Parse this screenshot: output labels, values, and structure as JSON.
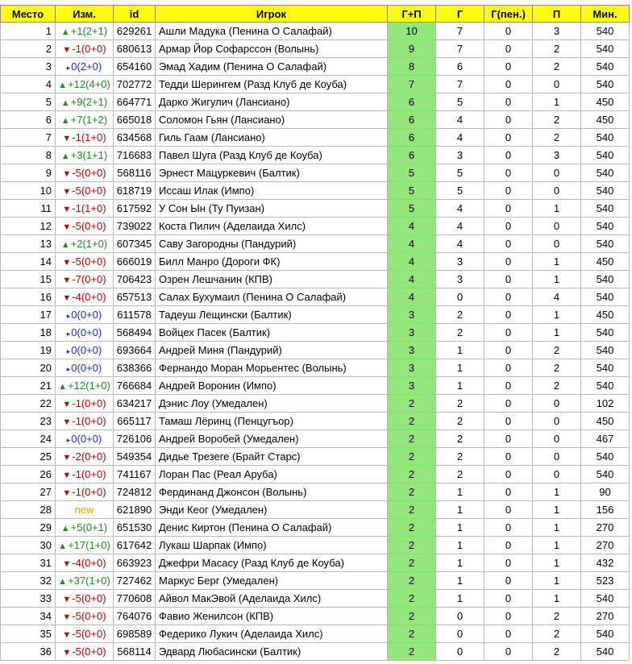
{
  "headers": [
    "Место",
    "Изм.",
    "id",
    "Игрок",
    "Г+П",
    "Г",
    "Г(пен.)",
    "П",
    "Мин."
  ],
  "colors": {
    "header_bg": "#ffff00",
    "gp_bg": "#92e67a",
    "up": "#1f8a1f",
    "down": "#c00000",
    "same": "#1530d0",
    "new": "#f0a000"
  },
  "rows": [
    {
      "place": "1",
      "dir": "up",
      "chg": "+1(2+1)",
      "id": "629261",
      "player": "Ашли Мадука (Пенина О Салафай)",
      "gp": "10",
      "g": "7",
      "gpen": "0",
      "p": "3",
      "min": "540"
    },
    {
      "place": "2",
      "dir": "down",
      "chg": "-1(0+0)",
      "id": "680613",
      "player": "Армар Йор Софарссон (Волынь)",
      "gp": "9",
      "g": "7",
      "gpen": "0",
      "p": "2",
      "min": "540"
    },
    {
      "place": "3",
      "dir": "same",
      "chg": "0(2+0)",
      "id": "654160",
      "player": "Эмад Хадим (Пенина О Салафай)",
      "gp": "8",
      "g": "6",
      "gpen": "0",
      "p": "2",
      "min": "540"
    },
    {
      "place": "4",
      "dir": "up",
      "chg": "+12(4+0)",
      "id": "702772",
      "player": "Тедди Шерингем (Разд Клуб де Коуба)",
      "gp": "7",
      "g": "7",
      "gpen": "0",
      "p": "0",
      "min": "540"
    },
    {
      "place": "5",
      "dir": "up",
      "chg": "+9(2+1)",
      "id": "664771",
      "player": "Дарко Жигулич (Лансиано)",
      "gp": "6",
      "g": "5",
      "gpen": "0",
      "p": "1",
      "min": "450"
    },
    {
      "place": "6",
      "dir": "up",
      "chg": "+7(1+2)",
      "id": "665018",
      "player": "Соломон Гьян (Лансиано)",
      "gp": "6",
      "g": "4",
      "gpen": "0",
      "p": "2",
      "min": "450"
    },
    {
      "place": "7",
      "dir": "down",
      "chg": "-1(1+0)",
      "id": "634568",
      "player": "Гиль Гаам (Лансиано)",
      "gp": "6",
      "g": "4",
      "gpen": "0",
      "p": "2",
      "min": "540"
    },
    {
      "place": "8",
      "dir": "up",
      "chg": "+3(1+1)",
      "id": "716683",
      "player": "Павел Шуга (Разд Клуб де Коуба)",
      "gp": "6",
      "g": "3",
      "gpen": "0",
      "p": "3",
      "min": "540"
    },
    {
      "place": "9",
      "dir": "down",
      "chg": "-5(0+0)",
      "id": "568116",
      "player": "Эрнест Мацуркевич (Балтик)",
      "gp": "5",
      "g": "5",
      "gpen": "0",
      "p": "0",
      "min": "540"
    },
    {
      "place": "10",
      "dir": "down",
      "chg": "-5(0+0)",
      "id": "618719",
      "player": "Иссаш Илак (Импо)",
      "gp": "5",
      "g": "5",
      "gpen": "0",
      "p": "0",
      "min": "540"
    },
    {
      "place": "11",
      "dir": "down",
      "chg": "-1(1+0)",
      "id": "617592",
      "player": "У Сон Ын (Ту Пуизан)",
      "gp": "5",
      "g": "4",
      "gpen": "0",
      "p": "1",
      "min": "540"
    },
    {
      "place": "12",
      "dir": "down",
      "chg": "-5(0+0)",
      "id": "739022",
      "player": "Коста Пилич (Аделаида Хилс)",
      "gp": "4",
      "g": "4",
      "gpen": "0",
      "p": "0",
      "min": "540"
    },
    {
      "place": "13",
      "dir": "up",
      "chg": "+2(1+0)",
      "id": "607345",
      "player": "Саву Загородны (Пандурий)",
      "gp": "4",
      "g": "4",
      "gpen": "0",
      "p": "0",
      "min": "540"
    },
    {
      "place": "14",
      "dir": "down",
      "chg": "-5(0+0)",
      "id": "666019",
      "player": "Билл Манро (Дороги ФК)",
      "gp": "4",
      "g": "3",
      "gpen": "0",
      "p": "1",
      "min": "450"
    },
    {
      "place": "15",
      "dir": "down",
      "chg": "-7(0+0)",
      "id": "706423",
      "player": "Озрен Лешчанин (КПВ)",
      "gp": "4",
      "g": "3",
      "gpen": "0",
      "p": "1",
      "min": "540"
    },
    {
      "place": "16",
      "dir": "down",
      "chg": "-4(0+0)",
      "id": "657513",
      "player": "Салах Бухумаил (Пенина О Салафай)",
      "gp": "4",
      "g": "0",
      "gpen": "0",
      "p": "4",
      "min": "540"
    },
    {
      "place": "17",
      "dir": "same",
      "chg": "0(0+0)",
      "id": "611578",
      "player": "Тадеуш Лещински (Балтик)",
      "gp": "3",
      "g": "2",
      "gpen": "0",
      "p": "1",
      "min": "450"
    },
    {
      "place": "18",
      "dir": "same",
      "chg": "0(0+0)",
      "id": "568494",
      "player": "Войцех Пасек (Балтик)",
      "gp": "3",
      "g": "2",
      "gpen": "0",
      "p": "1",
      "min": "540"
    },
    {
      "place": "19",
      "dir": "same",
      "chg": "0(0+0)",
      "id": "693664",
      "player": "Андрей Миня (Пандурий)",
      "gp": "3",
      "g": "1",
      "gpen": "0",
      "p": "2",
      "min": "540"
    },
    {
      "place": "20",
      "dir": "same",
      "chg": "0(0+0)",
      "id": "638366",
      "player": "Фернандо Моран Морьентес (Волынь)",
      "gp": "3",
      "g": "1",
      "gpen": "0",
      "p": "2",
      "min": "540"
    },
    {
      "place": "21",
      "dir": "up",
      "chg": "+12(1+0)",
      "id": "766684",
      "player": "Андрей Воронин (Импо)",
      "gp": "3",
      "g": "1",
      "gpen": "0",
      "p": "2",
      "min": "540"
    },
    {
      "place": "22",
      "dir": "down",
      "chg": "-1(0+0)",
      "id": "634217",
      "player": "Дэнис Лоу (Умедален)",
      "gp": "2",
      "g": "2",
      "gpen": "0",
      "p": "0",
      "min": "102"
    },
    {
      "place": "23",
      "dir": "down",
      "chg": "-1(0+0)",
      "id": "665117",
      "player": "Тамаш Лёринц (Пенцугъор)",
      "gp": "2",
      "g": "2",
      "gpen": "0",
      "p": "0",
      "min": "450"
    },
    {
      "place": "24",
      "dir": "same",
      "chg": "0(0+0)",
      "id": "726106",
      "player": "Андрей Воробей (Умедален)",
      "gp": "2",
      "g": "2",
      "gpen": "0",
      "p": "0",
      "min": "467"
    },
    {
      "place": "25",
      "dir": "down",
      "chg": "-2(0+0)",
      "id": "549354",
      "player": "Дидье Трезеге (Брайт Старс)",
      "gp": "2",
      "g": "2",
      "gpen": "0",
      "p": "0",
      "min": "540"
    },
    {
      "place": "26",
      "dir": "down",
      "chg": "-1(0+0)",
      "id": "741167",
      "player": "Лоран Пас (Реал Аруба)",
      "gp": "2",
      "g": "2",
      "gpen": "0",
      "p": "0",
      "min": "540"
    },
    {
      "place": "27",
      "dir": "down",
      "chg": "-1(0+0)",
      "id": "724812",
      "player": "Фердинанд Джонсон (Волынь)",
      "gp": "2",
      "g": "1",
      "gpen": "0",
      "p": "1",
      "min": "90"
    },
    {
      "place": "28",
      "dir": "new",
      "chg": "new",
      "id": "621890",
      "player": "Энди Кеог (Умедален)",
      "gp": "2",
      "g": "1",
      "gpen": "0",
      "p": "1",
      "min": "156"
    },
    {
      "place": "29",
      "dir": "up",
      "chg": "+5(0+1)",
      "id": "651530",
      "player": "Денис Киртон (Пенина О Салафай)",
      "gp": "2",
      "g": "1",
      "gpen": "0",
      "p": "1",
      "min": "270"
    },
    {
      "place": "30",
      "dir": "up",
      "chg": "+17(1+0)",
      "id": "617642",
      "player": "Лукаш Шарпак (Импо)",
      "gp": "2",
      "g": "1",
      "gpen": "0",
      "p": "1",
      "min": "270"
    },
    {
      "place": "31",
      "dir": "down",
      "chg": "-4(0+0)",
      "id": "663923",
      "player": "Джефри Масасу (Разд Клуб де Коуба)",
      "gp": "2",
      "g": "1",
      "gpen": "0",
      "p": "1",
      "min": "432"
    },
    {
      "place": "32",
      "dir": "up",
      "chg": "+37(1+0)",
      "id": "727462",
      "player": "Маркус Берг (Умедален)",
      "gp": "2",
      "g": "1",
      "gpen": "0",
      "p": "1",
      "min": "523"
    },
    {
      "place": "33",
      "dir": "down",
      "chg": "-5(0+0)",
      "id": "770608",
      "player": "Айвол МакЭвой (Аделаида Хилс)",
      "gp": "2",
      "g": "1",
      "gpen": "0",
      "p": "1",
      "min": "540"
    },
    {
      "place": "34",
      "dir": "down",
      "chg": "-5(0+0)",
      "id": "764076",
      "player": "Фавио Женилсон (КПВ)",
      "gp": "2",
      "g": "0",
      "gpen": "0",
      "p": "2",
      "min": "270"
    },
    {
      "place": "35",
      "dir": "down",
      "chg": "-5(0+0)",
      "id": "698589",
      "player": "Федерико Лукич (Аделаида Хилс)",
      "gp": "2",
      "g": "0",
      "gpen": "0",
      "p": "2",
      "min": "540"
    },
    {
      "place": "36",
      "dir": "down",
      "chg": "-5(0+0)",
      "id": "568114",
      "player": "Эдвард Любасински (Балтик)",
      "gp": "2",
      "g": "0",
      "gpen": "0",
      "p": "2",
      "min": "540"
    }
  ]
}
